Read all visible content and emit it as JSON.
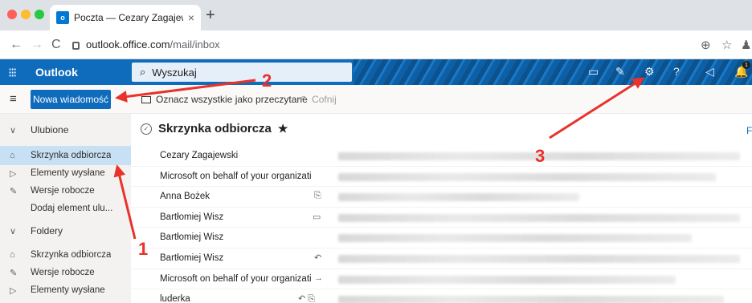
{
  "browser": {
    "tab_title": "Poczta — Cezary Zagajewski —",
    "tab_close": "×",
    "new_tab": "+",
    "url_domain": "outlook.office.com",
    "url_path": "/mail/inbox",
    "nav_back": "←",
    "nav_forward": "→",
    "nav_reload": "C",
    "favicon_letter": "o",
    "right_icons": [
      "⊕",
      "☆",
      "♟"
    ]
  },
  "header": {
    "waffle": "⁝⁝⁝",
    "brand": "Outlook",
    "search_placeholder": "Wyszukaj",
    "search_icon": "⌕",
    "icons": [
      "▭",
      "✎",
      "⚙",
      "?",
      "◁",
      "🔔"
    ],
    "notification_count": "1"
  },
  "commandbar": {
    "menu_icon": "≡",
    "new_message": "Nowa wiadomość",
    "mark_all_read": "Oznacz wszystkie jako przeczytane",
    "undo_icon": "↶",
    "undo": "Cofnij"
  },
  "leftnav": {
    "items": [
      {
        "icon": "∨",
        "label": "Ulubione"
      },
      {
        "icon": "⌂",
        "label": "Skrzynka odbiorcza"
      },
      {
        "icon": "▷",
        "label": "Elementy wysłane"
      },
      {
        "icon": "✎",
        "label": "Wersje robocze"
      },
      {
        "icon": "",
        "label": "Dodaj element ulu..."
      },
      {
        "icon": "∨",
        "label": "Foldery"
      },
      {
        "icon": "⌂",
        "label": "Skrzynka odbiorcza"
      },
      {
        "icon": "✎",
        "label": "Wersje robocze"
      },
      {
        "icon": "▷",
        "label": "Elementy wysłane"
      }
    ]
  },
  "inbox": {
    "title": "Skrzynka odbiorcza",
    "check_icon": "✓",
    "star": "★",
    "filter": "Fi",
    "rows": [
      {
        "sender": "Cezary Zagajewski",
        "icon": ""
      },
      {
        "sender": "Microsoft on behalf of your organization",
        "icon": ""
      },
      {
        "sender": "Anna Bożek",
        "icon": "⎘"
      },
      {
        "sender": "Bartłomiej Wisz",
        "icon": "▭"
      },
      {
        "sender": "Bartłomiej Wisz",
        "icon": ""
      },
      {
        "sender": "Bartłomiej Wisz",
        "icon": "↶"
      },
      {
        "sender": "Microsoft on behalf of your organizatic",
        "icon": "→"
      },
      {
        "sender": "luderka",
        "icon": "↶ ⎘"
      }
    ]
  },
  "annotations": {
    "labels": [
      "1",
      "2",
      "3"
    ],
    "color": "#e8322b"
  }
}
